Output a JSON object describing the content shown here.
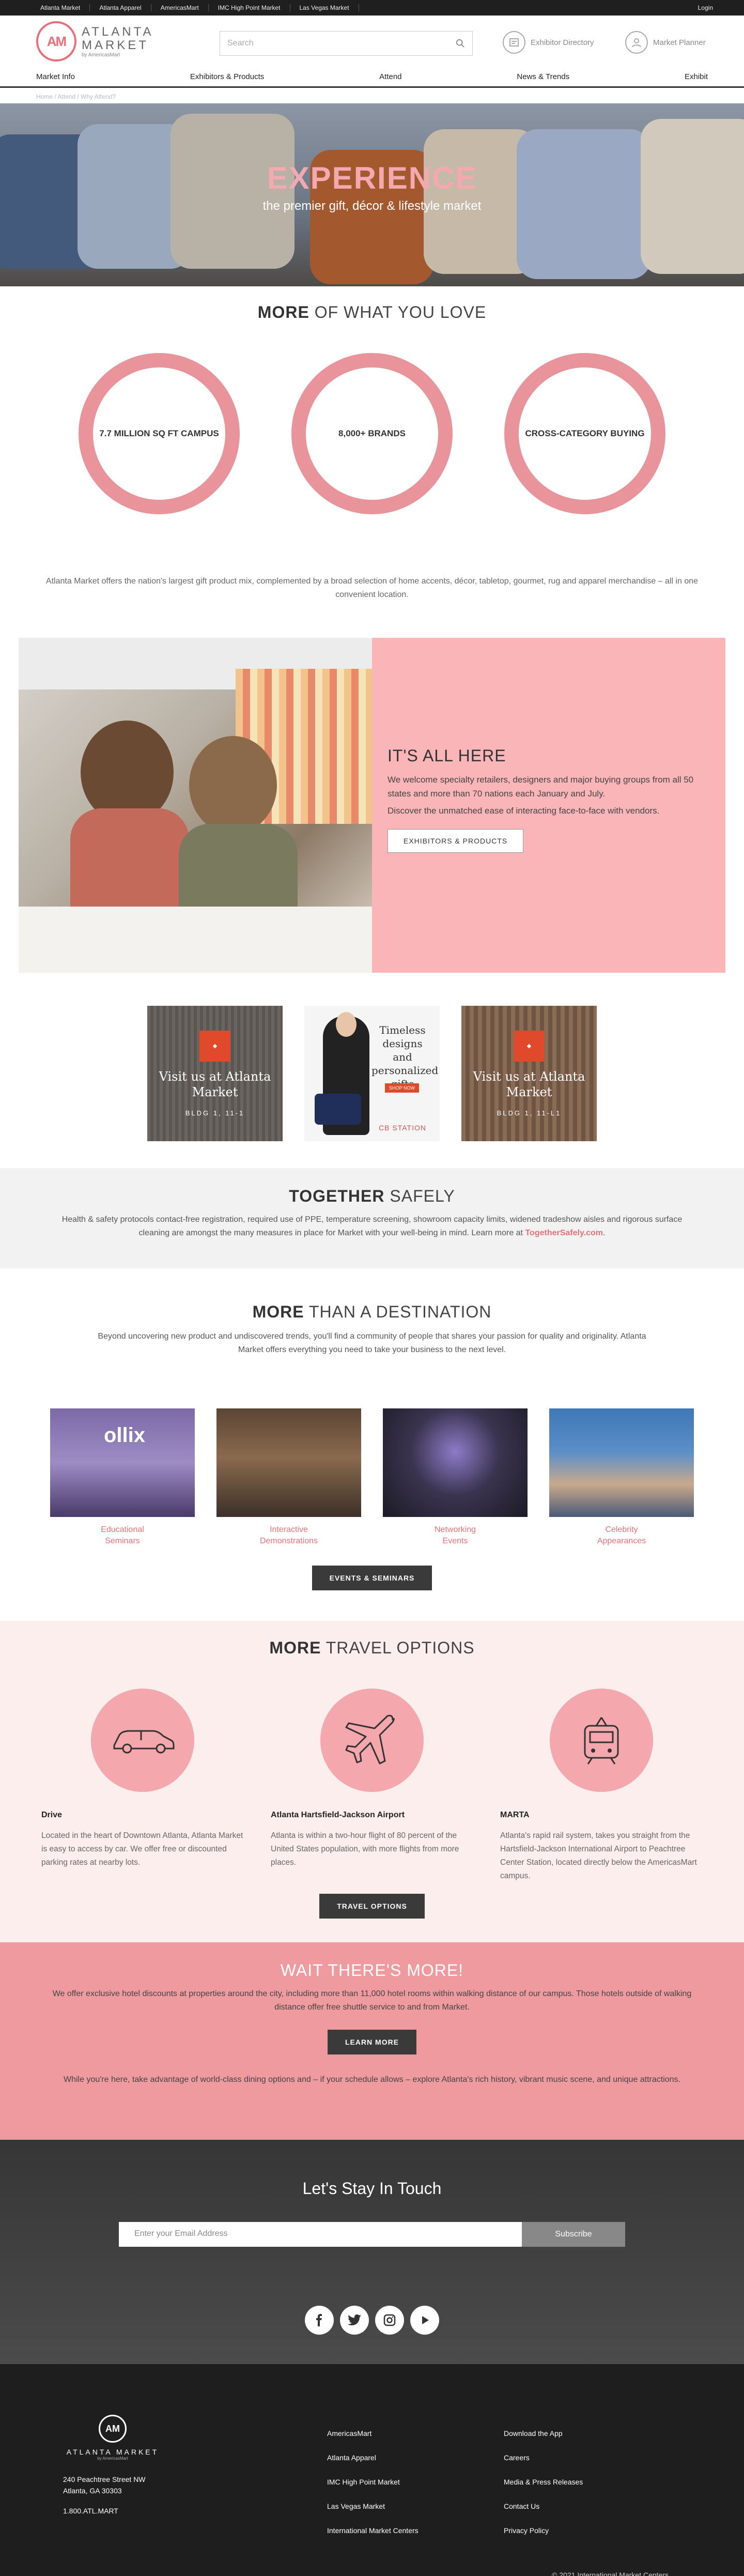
{
  "topbar": {
    "links": [
      "Atlanta Market",
      "Atlanta Apparel",
      "AmericasMart",
      "IMC High Point Market",
      "Las Vegas Market"
    ],
    "login": "Login"
  },
  "header": {
    "logo_mark": "AM",
    "logo_line1": "ATLANTA",
    "logo_line2": "MARKET",
    "logo_sub": "by AmericasMart",
    "search_placeholder": "Search",
    "exhibitor_directory": "Exhibitor Directory",
    "market_planner": "Market Planner"
  },
  "nav": {
    "items": [
      "Market Info",
      "Exhibitors & Products",
      "Attend",
      "News & Trends",
      "Exhibit"
    ]
  },
  "breadcrumb": "Home / Attend / Why Attend?",
  "hero": {
    "title": "EXPERIENCE",
    "subtitle": "the premier gift, décor & lifestyle market"
  },
  "love": {
    "title_bold": "MORE",
    "title_rest": " OF WHAT YOU LOVE",
    "stats": [
      "7.7 MILLION SQ FT CAMPUS",
      "8,000+ BRANDS",
      "CROSS-CATEGORY BUYING"
    ],
    "para": "Atlanta Market offers the nation's largest gift product mix, complemented by a broad selection of home accents, décor, tabletop, gourmet, rug and apparel merchandise – all in one convenient location."
  },
  "allhere": {
    "title": "IT'S ALL HERE",
    "p1": "We welcome specialty retailers, designers and major buying groups from all 50 states and more than 70 nations each January and July.",
    "p2": "Discover the unmatched ease of interacting face-to-face with vendors.",
    "button": "EXHIBITORS & PRODUCTS"
  },
  "promos": {
    "p1_text": "Visit us at Atlanta Market",
    "p1_tag": "BLDG 1, 11-1",
    "p2_script": "Timeless designs and personalized gifts",
    "p2_shop": "SHOP NOW",
    "p2_brand": "CB STATION",
    "p3_text": "Visit us at Atlanta Market",
    "p3_tag": "BLDG 1, 11-L1"
  },
  "together": {
    "title_bold": "TOGETHER",
    "title_rest": " SAFELY",
    "para": "Health & safety protocols contact-free registration, required use of PPE, temperature screening, showroom capacity limits, widened tradeshow aisles and rigorous surface cleaning are amongst the many measures in place for Market with your well-being in mind. Learn more at ",
    "link": "TogetherSafely.com",
    "end": "."
  },
  "dest": {
    "title_bold": "MORE",
    "title_rest": " THAN A DESTINATION",
    "para": "Beyond uncovering new product and undiscovered trends, you'll find a community of people that shares your passion for quality and originality. Atlanta Market offers everything you need to take your business to the next level.",
    "cards": [
      {
        "l1": "Educational",
        "l2": "Seminars"
      },
      {
        "l1": "Interactive",
        "l2": "Demonstrations"
      },
      {
        "l1": "Networking",
        "l2": "Events"
      },
      {
        "l1": "Celebrity",
        "l2": "Appearances"
      }
    ],
    "button": "EVENTS & SEMINARS",
    "card1_sign": "ollix"
  },
  "travel": {
    "title_bold": "MORE",
    "title_rest": " TRAVEL OPTIONS",
    "cols": [
      {
        "title": "Drive",
        "text": "Located in the heart of Downtown Atlanta, Atlanta Market is easy to access by car. We offer free or discounted parking rates at nearby lots."
      },
      {
        "title": "Atlanta Hartsfield-Jackson Airport",
        "text": "Atlanta is within a two-hour flight of 80 percent of the United States population, with more flights from more places."
      },
      {
        "title": "MARTA",
        "text": "Atlanta's rapid rail system, takes you straight from the Hartsfield-Jackson International Airport to Peachtree Center Station, located directly below the AmericasMart campus."
      }
    ],
    "button": "TRAVEL OPTIONS"
  },
  "wait": {
    "title": "WAIT THERE'S MORE!",
    "p1": "We offer exclusive hotel discounts at properties around the city, including more than 11,000 hotel rooms within walking distance of our campus. Those hotels outside of walking distance offer free shuttle service to and from Market.",
    "button": "LEARN MORE",
    "p2": "While you're here, take advantage of world-class dining options and – if your schedule allows – explore Atlanta's rich history, vibrant music scene, and unique attractions."
  },
  "touch": {
    "title": "Let's Stay In Touch",
    "email_placeholder": "Enter your Email Address",
    "subscribe": "Subscribe"
  },
  "footer": {
    "logo_mark": "AM",
    "logo_name": "ATLANTA MARKET",
    "logo_sub": "by AmericasMart",
    "addr1": "240 Peachtree Street NW",
    "addr2": "Atlanta, GA 30303",
    "phone": "1.800.ATL.MART",
    "col1": [
      "AmericasMart",
      "Atlanta Apparel",
      "IMC High Point Market",
      "Las Vegas Market",
      "International Market Centers"
    ],
    "col2": [
      "Download the App",
      "Careers",
      "Media & Press Releases",
      "Contact Us",
      "Privacy Policy"
    ],
    "copyright": "© 2021 International Market Centers"
  }
}
